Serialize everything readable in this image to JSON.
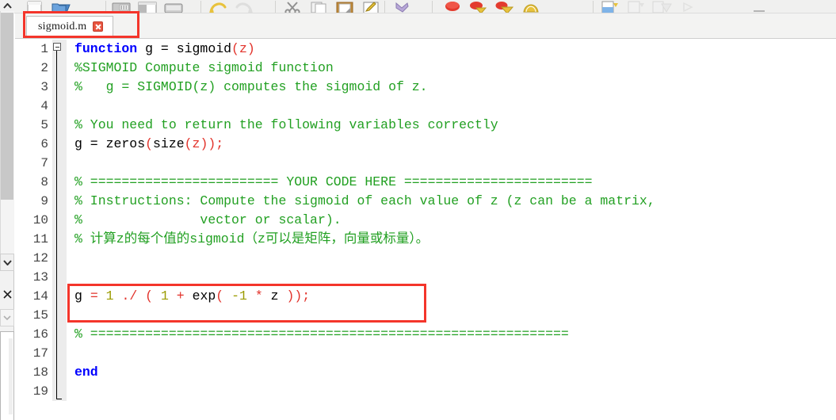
{
  "window": {
    "app": "MATLAB Editor"
  },
  "toolbar": {
    "icons": [
      {
        "name": "new-script-icon",
        "label": "New Script"
      },
      {
        "name": "open-file-icon",
        "label": "Open"
      },
      {
        "name": "save-icon",
        "label": "Save"
      },
      {
        "name": "compare-icon",
        "label": "Compare"
      },
      {
        "name": "print-icon",
        "label": "Print"
      },
      {
        "name": "cut-icon",
        "label": "Cut"
      },
      {
        "name": "copy-icon",
        "label": "Copy"
      },
      {
        "name": "paste-icon",
        "label": "Paste"
      },
      {
        "name": "edit-icon",
        "label": "Edit"
      },
      {
        "name": "undo-icon",
        "label": "Undo"
      },
      {
        "name": "redo-icon",
        "label": "Redo"
      },
      {
        "name": "breakpoint-icon",
        "label": "Breakpoint"
      },
      {
        "name": "run-icon",
        "label": "Run"
      },
      {
        "name": "run-and-advance-icon",
        "label": "Run and Advance"
      },
      {
        "name": "run-section-icon",
        "label": "Run Section"
      },
      {
        "name": "step-icon",
        "label": "Step"
      },
      {
        "name": "step-in-icon",
        "label": "Step In"
      },
      {
        "name": "step-out-icon",
        "label": "Step Out"
      },
      {
        "name": "continue-icon",
        "label": "Continue"
      },
      {
        "name": "stop-icon",
        "label": "Stop"
      }
    ]
  },
  "left_rail": {
    "scroll_up_icon": "chevron-up-icon",
    "scroll_down_icon": "chevron-down-icon",
    "close_icon": "close-icon",
    "collapse_icon": "chevron-down-icon"
  },
  "tab": {
    "label": "sigmoid.m",
    "close_icon": "close-icon"
  },
  "annotations": {
    "tab_highlight_color": "#f4352b",
    "code_highlight_color": "#f4352b"
  },
  "editor": {
    "fold_marker": "collapse-fold-icon",
    "lines": [
      {
        "n": "1",
        "tokens": [
          {
            "t": "function",
            "c": "kw"
          },
          {
            "t": " g = sigmoid",
            "c": "blk"
          },
          {
            "t": "(z)",
            "c": "red"
          }
        ]
      },
      {
        "n": "2",
        "tokens": [
          {
            "t": "%SIGMOID Compute sigmoid function",
            "c": "cmt"
          }
        ]
      },
      {
        "n": "3",
        "tokens": [
          {
            "t": "%   g = SIGMOID(z) computes the sigmoid of z.",
            "c": "cmt"
          }
        ]
      },
      {
        "n": "4",
        "tokens": []
      },
      {
        "n": "5",
        "tokens": [
          {
            "t": "% You need to return the following variables correctly",
            "c": "cmt"
          }
        ]
      },
      {
        "n": "6",
        "tokens": [
          {
            "t": "g = zeros",
            "c": "blk"
          },
          {
            "t": "(",
            "c": "red"
          },
          {
            "t": "size",
            "c": "blk"
          },
          {
            "t": "(z));",
            "c": "red"
          }
        ]
      },
      {
        "n": "7",
        "tokens": []
      },
      {
        "n": "8",
        "tokens": [
          {
            "t": "% ======================== YOUR CODE HERE ========================",
            "c": "cmt"
          }
        ]
      },
      {
        "n": "9",
        "tokens": [
          {
            "t": "% Instructions: Compute the sigmoid of each value of z (z can be a matrix,",
            "c": "cmt"
          }
        ]
      },
      {
        "n": "10",
        "tokens": [
          {
            "t": "%               vector or scalar).",
            "c": "cmt"
          }
        ]
      },
      {
        "n": "11",
        "tokens": [
          {
            "t": "% 计算z的每个值的sigmoid（z可以是矩阵，向量或标量）。",
            "c": "cmt"
          }
        ]
      },
      {
        "n": "12",
        "tokens": []
      },
      {
        "n": "13",
        "tokens": []
      },
      {
        "n": "14",
        "tokens": [
          {
            "t": "g ",
            "c": "blk"
          },
          {
            "t": "= ",
            "c": "red"
          },
          {
            "t": "1 ",
            "c": "num"
          },
          {
            "t": "./ ( ",
            "c": "red"
          },
          {
            "t": "1 ",
            "c": "num"
          },
          {
            "t": "+ ",
            "c": "red"
          },
          {
            "t": "exp",
            "c": "blk"
          },
          {
            "t": "( ",
            "c": "red"
          },
          {
            "t": "-1 ",
            "c": "num"
          },
          {
            "t": "* ",
            "c": "red"
          },
          {
            "t": "z ",
            "c": "blk"
          },
          {
            "t": "));",
            "c": "red"
          }
        ]
      },
      {
        "n": "15",
        "tokens": []
      },
      {
        "n": "16",
        "tokens": [
          {
            "t": "% =============================================================",
            "c": "cmt"
          }
        ]
      },
      {
        "n": "17",
        "tokens": []
      },
      {
        "n": "18",
        "tokens": [
          {
            "t": "end",
            "c": "kw"
          }
        ]
      },
      {
        "n": "19",
        "tokens": []
      }
    ]
  }
}
